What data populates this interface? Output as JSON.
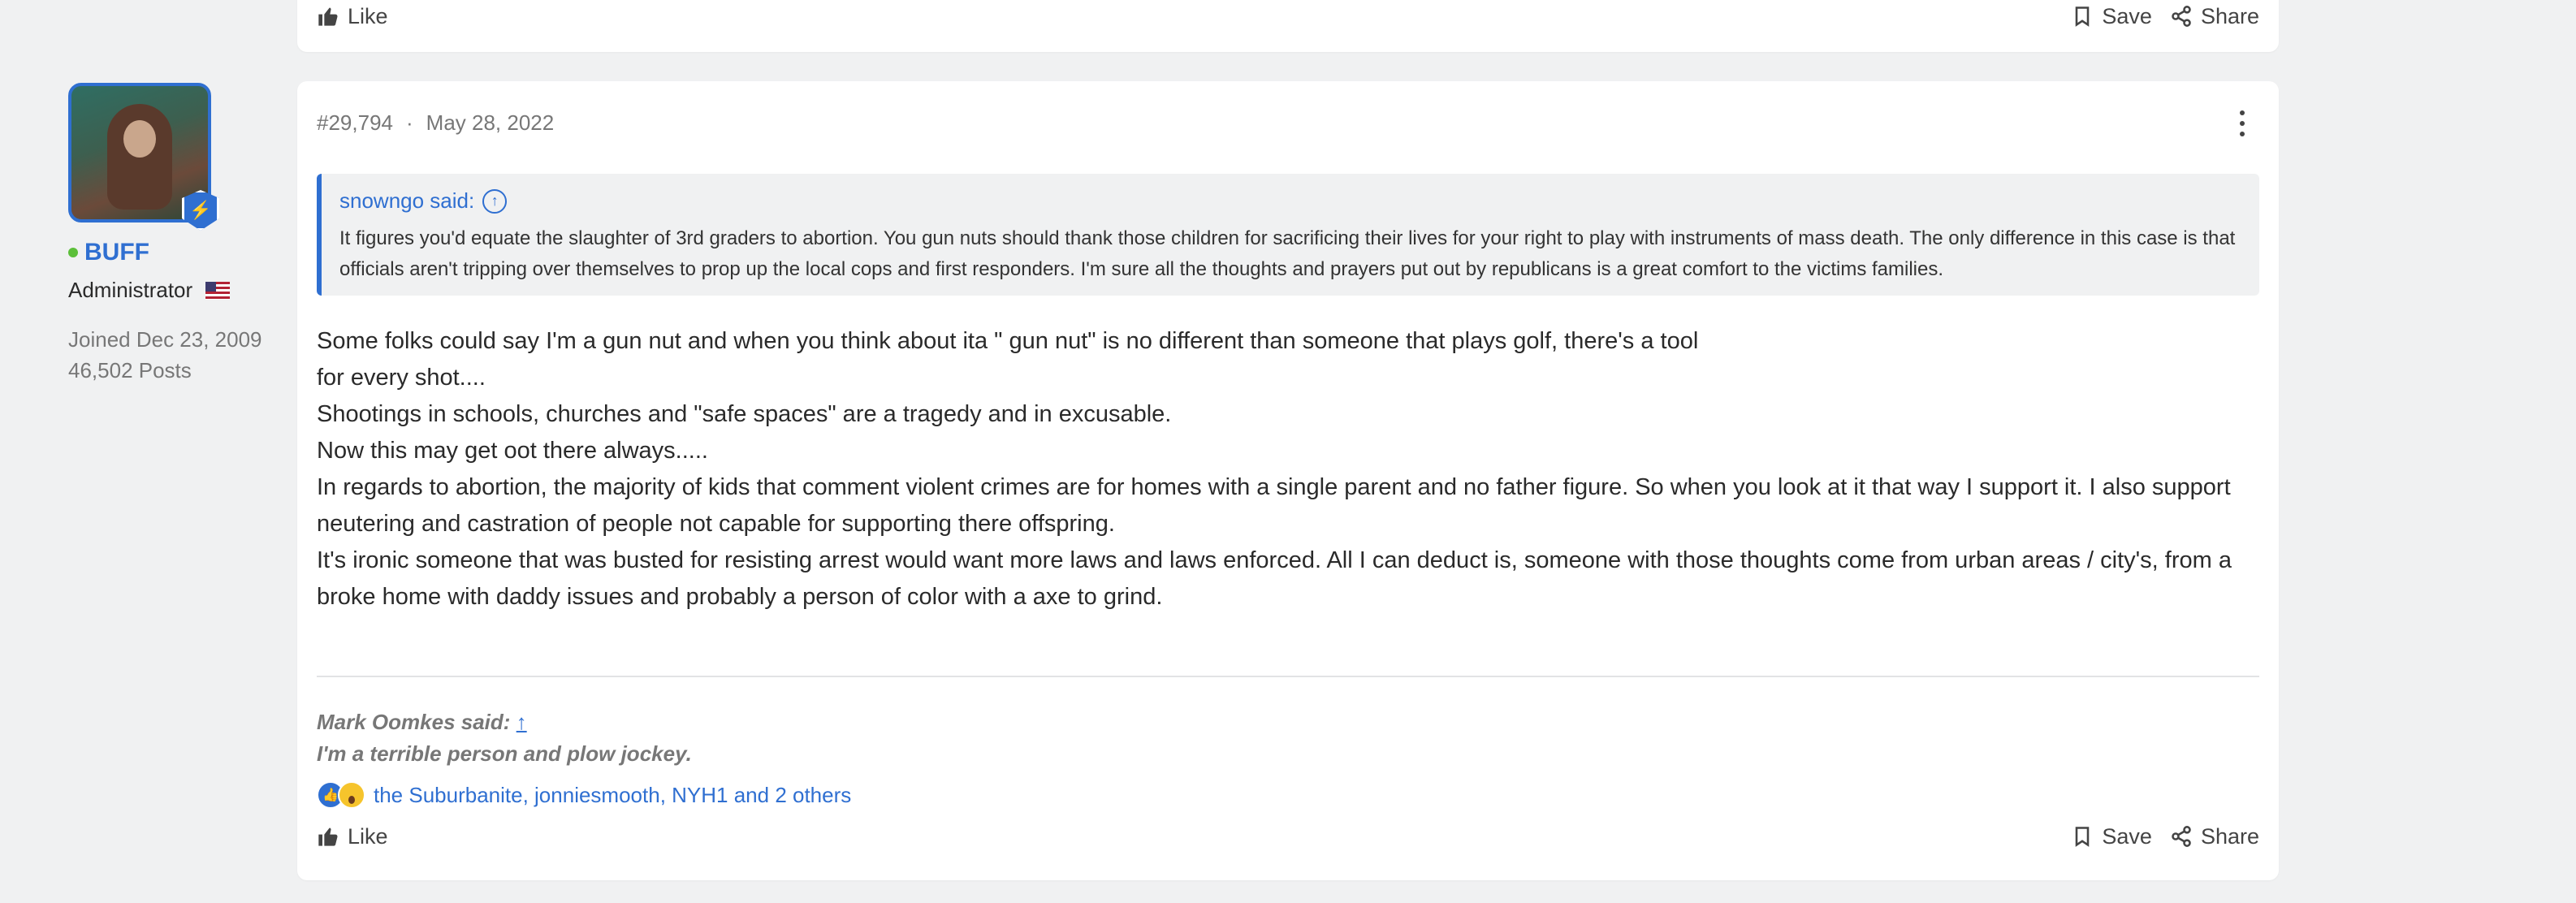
{
  "top_card": {
    "like": "Like",
    "save": "Save",
    "share": "Share"
  },
  "author": {
    "name": "BUFF",
    "role": "Administrator",
    "joined": "Joined Dec 23, 2009",
    "posts": "46,502 Posts"
  },
  "post": {
    "number": "#29,794",
    "separator": "·",
    "date": "May 28, 2022",
    "quote": {
      "author": "snowngo said:",
      "text": "It figures you'd equate the slaughter of 3rd graders to abortion. You gun nuts should thank those children for sacrificing their lives for your right to play with instruments of mass death. The only difference in this case is that officials aren't tripping over themselves to prop up the local cops and first responders. I'm sure all the thoughts and prayers put out by republicans is a great comfort to the victims families."
    },
    "body": [
      "Some folks could say I'm a gun nut and when you think about ita \" gun nut\" is no different than someone that plays golf, there's a tool",
      "for every shot....",
      "Shootings in schools, churches and \"safe spaces\" are a tragedy and in excusable.",
      "Now this may get oot there always.....",
      "In regards to abortion, the majority of kids that comment violent crimes are for homes with a single parent and no father figure. So when you look at it that way I support it. I also support neutering and castration of people not capable for supporting there offspring.",
      "It's ironic someone that was busted for resisting arrest would want more laws and laws enforced. All I can deduct is, someone with those thoughts come from urban areas / city's, from a broke home with daddy issues and probably a person of color with a axe to grind."
    ],
    "signature": {
      "author": "Mark Oomkes said:",
      "link": "↑",
      "text": "I'm a terrible person and plow jockey."
    },
    "reactions": "the Suburbanite, jonniesmooth, NYH1 and 2 others",
    "actions": {
      "like": "Like",
      "save": "Save",
      "share": "Share"
    }
  },
  "colors": {
    "accent": "#2f6fd1",
    "online": "#5cbf3a",
    "background": "#f0f1f2"
  }
}
